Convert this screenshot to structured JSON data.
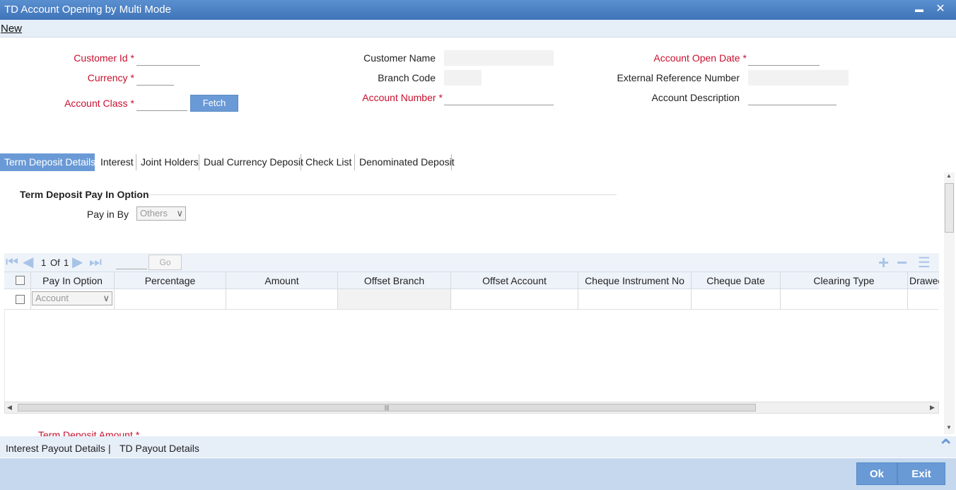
{
  "window": {
    "title": "TD Account Opening by Multi Mode",
    "minimize": "▬",
    "close": "✕"
  },
  "menu": {
    "new_label": "New"
  },
  "form": {
    "customer_id": {
      "label": "Customer Id",
      "value": ""
    },
    "currency": {
      "label": "Currency",
      "value": ""
    },
    "account_class": {
      "label": "Account Class",
      "value": ""
    },
    "fetch_label": "Fetch",
    "customer_name": {
      "label": "Customer Name",
      "value": ""
    },
    "branch_code": {
      "label": "Branch Code",
      "value": ""
    },
    "account_number": {
      "label": "Account Number",
      "value": ""
    },
    "account_open_date": {
      "label": "Account Open Date",
      "value": ""
    },
    "external_ref": {
      "label": "External Reference Number",
      "value": ""
    },
    "account_description": {
      "label": "Account Description",
      "value": ""
    },
    "required_mark": "*"
  },
  "tabs": [
    "Term Deposit Details",
    "Interest",
    "Joint Holders",
    "Dual Currency Deposit",
    "Check List",
    "Denominated Deposit"
  ],
  "payin": {
    "section_title": "Term Deposit Pay In Option",
    "pay_in_by_label": "Pay in By",
    "pay_in_by_value": "Others"
  },
  "grid": {
    "page_current": "1",
    "page_of": "Of",
    "page_total": "1",
    "go_label": "Go",
    "columns": [
      "Pay In Option",
      "Percentage",
      "Amount",
      "Offset Branch",
      "Offset Account",
      "Cheque Instrument No",
      "Cheque Date",
      "Clearing Type",
      "Drawee"
    ],
    "row_pay_in_option": "Account",
    "scroll_grip": "|||"
  },
  "term_deposit_amount_label": "Term Deposit Amount",
  "footer": {
    "links": [
      "Interest Payout Details",
      "TD Payout Details"
    ],
    "link_sep": "|",
    "ok_label": "Ok",
    "exit_label": "Exit"
  },
  "colors": {
    "accent": "#6a9ad6",
    "required": "#c8102e",
    "titlebar": "#4a7fc1"
  }
}
